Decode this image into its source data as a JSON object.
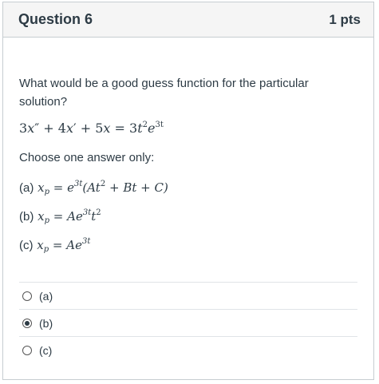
{
  "question": {
    "title": "Question 6",
    "points": "1 pts",
    "prompt": "What would be a good guess function for the particular solution?",
    "equation": {
      "a": "3",
      "b": "x",
      "c": "″",
      "d": " + 4",
      "e": "x",
      "f": "′",
      "g": " + 5",
      "h": "x",
      "i": " = 3",
      "j": "t",
      "k": "2",
      "l": "e",
      "m": "3t"
    },
    "instruction": "Choose one answer only:",
    "options": [
      {
        "label": "(a)",
        "lhs": "x",
        "sub": "p",
        "eq": " = ",
        "rhs1": "e",
        "sup1": "3t",
        "rhs2": "(At",
        "sup2": "2",
        "rhs3": " + Bt + C)"
      },
      {
        "label": "(b)",
        "lhs": "x",
        "sub": "p",
        "eq": " = ",
        "rhs1": "Ae",
        "sup1": "3t",
        "rhs2": "t",
        "sup2": "2"
      },
      {
        "label": "(c)",
        "lhs": "x",
        "sub": "p",
        "eq": " = ",
        "rhs1": "Ae",
        "sup1": "3t"
      }
    ]
  },
  "answers": [
    {
      "label": "(a)",
      "selected": false
    },
    {
      "label": "(b)",
      "selected": true
    },
    {
      "label": "(c)",
      "selected": false
    }
  ]
}
